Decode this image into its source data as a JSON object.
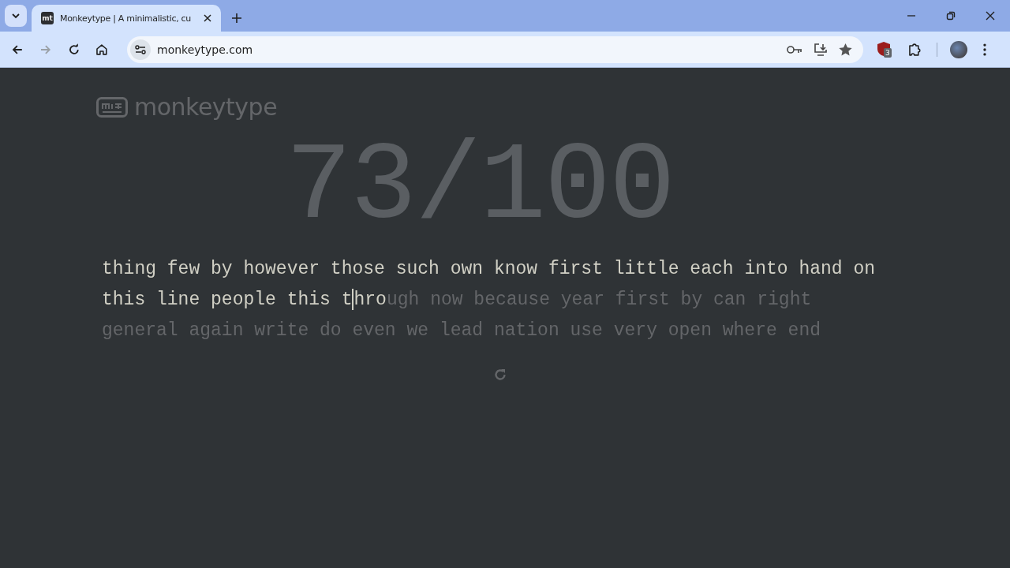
{
  "browser": {
    "tab": {
      "title": "Monkeytype | A minimalistic, cu",
      "favicon": "mt",
      "selected": true
    },
    "address": "monkeytype.com",
    "extension_badge": "3"
  },
  "page": {
    "logo": "monkeytype",
    "counter": "73/100",
    "lines": [
      [
        {
          "text": "thing",
          "kind": "typed"
        },
        {
          "text": "few",
          "kind": "typed"
        },
        {
          "text": "by",
          "kind": "typed"
        },
        {
          "text": "however",
          "kind": "typed"
        },
        {
          "text": "those",
          "kind": "typed"
        },
        {
          "text": "such",
          "kind": "typed"
        },
        {
          "text": "own",
          "kind": "typed"
        },
        {
          "text": "know",
          "kind": "typed"
        },
        {
          "text": "first",
          "kind": "typed"
        },
        {
          "text": "little",
          "kind": "typed"
        },
        {
          "text": "each",
          "kind": "typed"
        },
        {
          "text": "into",
          "kind": "typed"
        },
        {
          "text": "hand",
          "kind": "typed"
        },
        {
          "text": "on",
          "kind": "typed"
        }
      ],
      [
        {
          "text": "this",
          "kind": "typed"
        },
        {
          "text": "line",
          "kind": "typed"
        },
        {
          "text": "people",
          "kind": "typed"
        },
        {
          "text": "this",
          "kind": "typed"
        },
        {
          "kind": "current",
          "segments": [
            {
              "kind": "typed",
              "text": "t"
            },
            {
              "kind": "caret"
            },
            {
              "kind": "typed",
              "text": "hro"
            },
            {
              "kind": "untyped",
              "text": "ugh"
            }
          ]
        },
        {
          "text": "now",
          "kind": "untyped"
        },
        {
          "text": "because",
          "kind": "untyped"
        },
        {
          "text": "year",
          "kind": "untyped"
        },
        {
          "text": "first",
          "kind": "untyped"
        },
        {
          "text": "by",
          "kind": "untyped"
        },
        {
          "text": "can",
          "kind": "untyped"
        },
        {
          "text": "right",
          "kind": "untyped"
        }
      ],
      [
        {
          "text": "general",
          "kind": "untyped"
        },
        {
          "text": "again",
          "kind": "untyped"
        },
        {
          "text": "write",
          "kind": "untyped"
        },
        {
          "text": "do",
          "kind": "untyped"
        },
        {
          "text": "even",
          "kind": "untyped"
        },
        {
          "text": "we",
          "kind": "untyped"
        },
        {
          "text": "lead",
          "kind": "untyped"
        },
        {
          "text": "nation",
          "kind": "untyped"
        },
        {
          "text": "use",
          "kind": "untyped"
        },
        {
          "text": "very",
          "kind": "untyped"
        },
        {
          "text": "open",
          "kind": "untyped"
        },
        {
          "text": "where",
          "kind": "untyped"
        },
        {
          "text": "end",
          "kind": "untyped"
        }
      ]
    ]
  }
}
